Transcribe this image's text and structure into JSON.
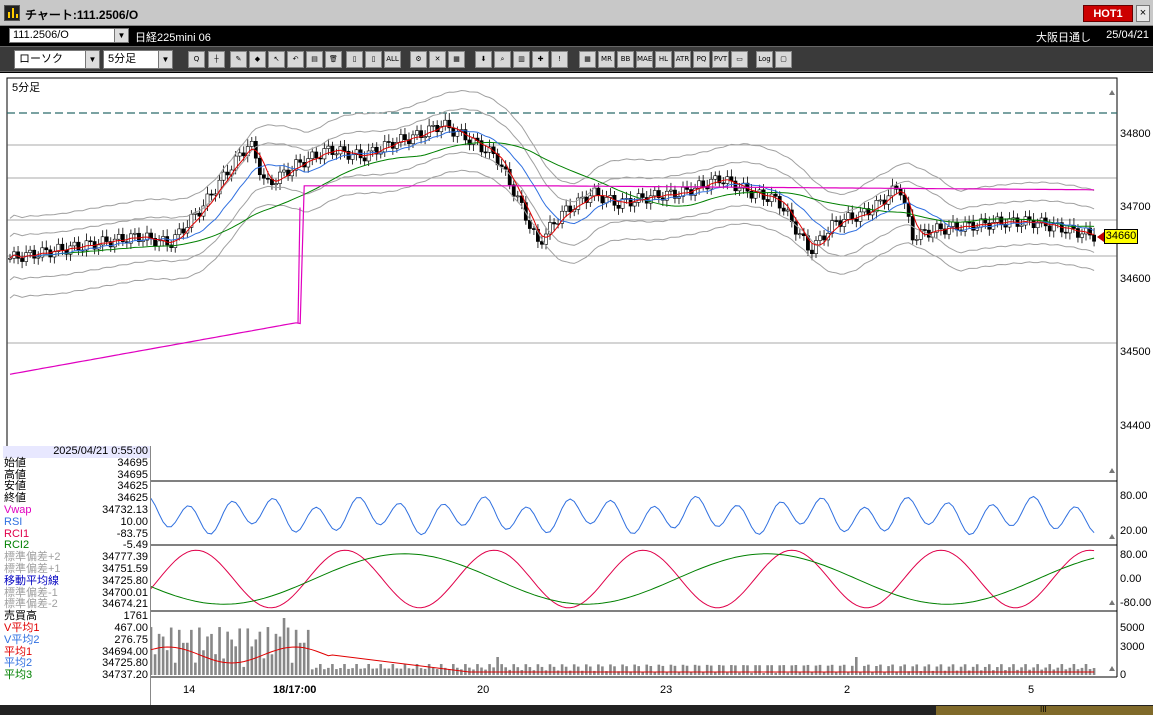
{
  "window": {
    "title": "チャート:111.2506/O",
    "hot_label": "HOT1",
    "close_label": "×"
  },
  "infobar": {
    "symbol": "111.2506/O",
    "instrument": "日経225mini 06",
    "session": "大阪日通し",
    "date": "25/04/21"
  },
  "toolbar": {
    "chart_type": "ローソク",
    "interval": "5分足"
  },
  "tool_icons": [
    "zoom-icon",
    "crosshair-icon",
    "pencil-icon",
    "eraser-icon",
    "cursor-icon",
    "undo-icon",
    "note-icon",
    "trash-icon",
    "bar-left-icon",
    "bar-right-icon",
    "all-icon",
    "gear-icon",
    "wrench-icon",
    "palette-icon",
    "down-arrow-icon",
    "magnifier-icon",
    "chart-icon",
    "cross-icon",
    "blank-icon",
    "ma-icon",
    "mr-icon",
    "bb-icon",
    "mae-icon",
    "hl-icon",
    "atr-icon",
    "pq-icon",
    "pvt-icon",
    "box-icon",
    "log-icon",
    "window-icon"
  ],
  "tool_labels": [
    "Q",
    "┼",
    "✎",
    "◆",
    "↖",
    "↶",
    "▤",
    "🗑",
    "▯",
    "▯",
    "ALL",
    "⚙",
    "✕",
    "▦",
    "⬇",
    "⌕",
    "▥",
    "✚",
    "!",
    "▦",
    "MR",
    "BB",
    "MAE",
    "HL",
    "ATR",
    "PQ",
    "PVT",
    "▭",
    "Log",
    "▢"
  ],
  "chart": {
    "period_label": "5分足",
    "current_price": "34660",
    "price_axis": [
      "34800",
      "34700",
      "34600",
      "34500",
      "34400"
    ],
    "rsi_axis": [
      "80.00",
      "20.00"
    ],
    "rci_axis": [
      "80.00",
      "0.00",
      "-80.00"
    ],
    "volume_axis": [
      "5000",
      "3000",
      "0"
    ],
    "x_labels": [
      "14",
      "18/17:00",
      "20",
      "23",
      "2",
      "5"
    ]
  },
  "info_panel": {
    "datetime": "2025/04/21 0:55:00",
    "rows": [
      {
        "label": "始値",
        "value": "34695",
        "color": "#000000"
      },
      {
        "label": "高値",
        "value": "34695",
        "color": "#000000"
      },
      {
        "label": "安値",
        "value": "34625",
        "color": "#000000"
      },
      {
        "label": "終値",
        "value": "34625",
        "color": "#000000"
      },
      {
        "label": "Vwap",
        "value": "34732.13",
        "color": "#e000c0"
      },
      {
        "label": "RSI",
        "value": "10.00",
        "color": "#3070e0"
      },
      {
        "label": "RCI1",
        "value": "-83.75",
        "color": "#e0004a"
      },
      {
        "label": "RCI2",
        "value": "-5.49",
        "color": "#008000"
      },
      {
        "label": "標準偏差+2",
        "value": "34777.39",
        "color": "#a0a0a0"
      },
      {
        "label": "標準偏差+1",
        "value": "34751.59",
        "color": "#a0a0a0"
      },
      {
        "label": "移動平均線",
        "value": "34725.80",
        "color": "#0000c0"
      },
      {
        "label": "標準偏差-1",
        "value": "34700.01",
        "color": "#a0a0a0"
      },
      {
        "label": "標準偏差-2",
        "value": "34674.21",
        "color": "#a0a0a0"
      },
      {
        "label": "売買高",
        "value": "1761",
        "color": "#000000"
      },
      {
        "label": "V平均1",
        "value": "467.00",
        "color": "#e00000"
      },
      {
        "label": "V平均2",
        "value": "276.75",
        "color": "#3070e0"
      },
      {
        "label": "平均1",
        "value": "34694.00",
        "color": "#e00000"
      },
      {
        "label": "平均2",
        "value": "34725.80",
        "color": "#3070e0"
      },
      {
        "label": "平均3",
        "value": "34737.20",
        "color": "#008000"
      }
    ]
  },
  "colors": {
    "up_candle": "#ffffff",
    "down_candle": "#000000",
    "ma1": "#e00000",
    "ma2": "#3070e0",
    "ma3": "#008000",
    "vwap": "#e000c0",
    "band": "#a0a0a0",
    "rsi": "#3070e0",
    "rci1": "#e0004a",
    "rci2": "#008000",
    "price_tag": "#ffff00"
  }
}
